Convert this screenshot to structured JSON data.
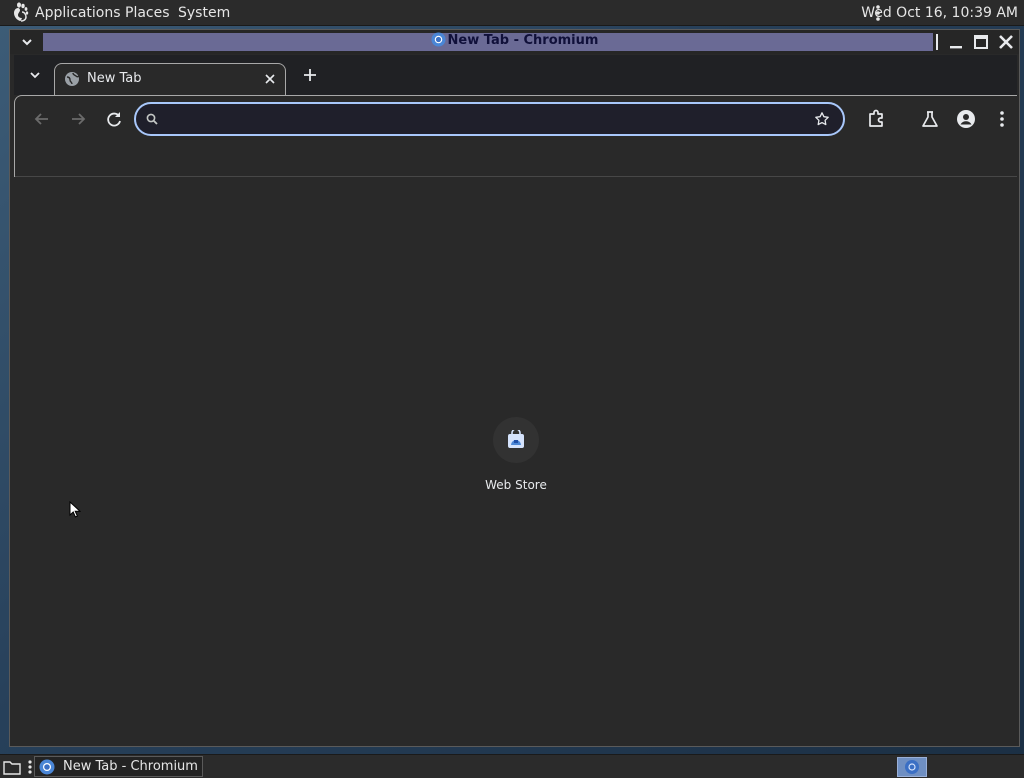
{
  "top_panel": {
    "menus": [
      "Applications",
      "Places",
      "System"
    ],
    "clock": "Wed Oct 16, 10:39 AM"
  },
  "window": {
    "title": "New Tab - Chromium"
  },
  "browser": {
    "tab": {
      "title": "New Tab"
    },
    "omnibox": {
      "value": "",
      "placeholder": ""
    },
    "shortcuts": [
      {
        "label": "Web Store"
      }
    ]
  },
  "taskbar": {
    "items": [
      {
        "label": "New Tab - Chromium"
      }
    ]
  },
  "colors": {
    "accent": "#a8c7fa",
    "titlebar_band": "#6a6a95",
    "workspace_active": "#6f8fc2"
  }
}
